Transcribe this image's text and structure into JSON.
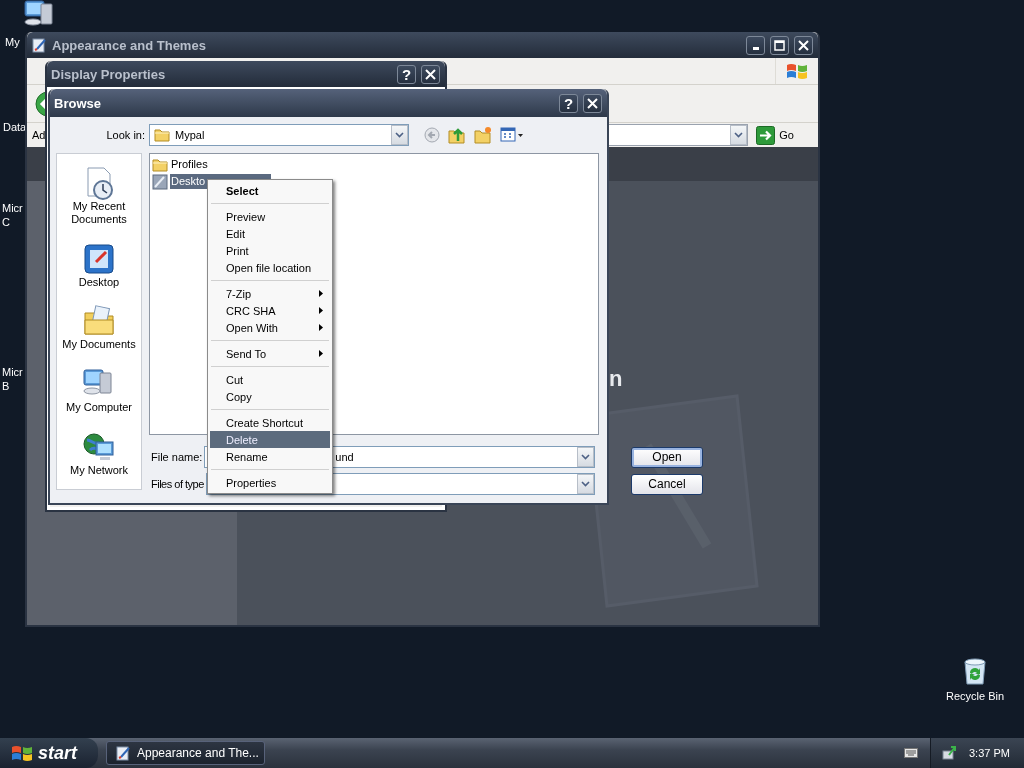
{
  "desktop": {
    "icons": [
      {
        "kind": "computer",
        "label_lines": [
          "My"
        ]
      },
      {
        "kind": "covered",
        "label_lines": [
          "Data"
        ]
      },
      {
        "kind": "covered",
        "label_lines": [
          "Micr",
          "C"
        ]
      },
      {
        "kind": "covered",
        "label_lines": [
          "Micr",
          "B"
        ]
      },
      {
        "kind": "recycle_bin",
        "label_lines": [
          "Recycle Bin"
        ]
      }
    ]
  },
  "appearance_window": {
    "title": "Appearance and Themes",
    "active": false,
    "address": {
      "label": "Ad",
      "go_label": "Go"
    },
    "pane_title_fragment": "n"
  },
  "display_properties_window": {
    "title": "Display Properties",
    "active": false,
    "help_label": "?"
  },
  "browse_dialog": {
    "title": "Browse",
    "active": true,
    "help_label": "?",
    "look_in": {
      "label": "Look in:",
      "value": "Mypal"
    },
    "places": [
      {
        "kind": "recent",
        "label": "My Recent Documents"
      },
      {
        "kind": "desktop",
        "label": "Desktop"
      },
      {
        "kind": "documents",
        "label": "My Documents"
      },
      {
        "kind": "computer",
        "label": "My Computer"
      },
      {
        "kind": "network",
        "label": "My Network"
      }
    ],
    "files": [
      {
        "kind": "folder",
        "name": "Profiles",
        "selected": false
      },
      {
        "kind": "image",
        "name": "Deskto",
        "selected": true
      }
    ],
    "file_name": {
      "label": "File name:",
      "value": "und"
    },
    "file_type": {
      "label": "Files of type"
    },
    "buttons": [
      {
        "label": "Open",
        "default": true
      },
      {
        "label": "Cancel",
        "default": false
      }
    ]
  },
  "context_menu": {
    "items": [
      {
        "kind": "item",
        "label": "Select",
        "bold": true,
        "submenu": false,
        "highlighted": false
      },
      {
        "kind": "separator"
      },
      {
        "kind": "item",
        "label": "Preview",
        "bold": false,
        "submenu": false,
        "highlighted": false
      },
      {
        "kind": "item",
        "label": "Edit",
        "bold": false,
        "submenu": false,
        "highlighted": false
      },
      {
        "kind": "item",
        "label": "Print",
        "bold": false,
        "submenu": false,
        "highlighted": false
      },
      {
        "kind": "item",
        "label": "Open file location",
        "bold": false,
        "submenu": false,
        "highlighted": false
      },
      {
        "kind": "separator"
      },
      {
        "kind": "item",
        "label": "7-Zip",
        "bold": false,
        "submenu": true,
        "highlighted": false
      },
      {
        "kind": "item",
        "label": "CRC SHA",
        "bold": false,
        "submenu": true,
        "highlighted": false
      },
      {
        "kind": "item",
        "label": "Open With",
        "bold": false,
        "submenu": true,
        "highlighted": false
      },
      {
        "kind": "separator"
      },
      {
        "kind": "item",
        "label": "Send To",
        "bold": false,
        "submenu": true,
        "highlighted": false
      },
      {
        "kind": "separator"
      },
      {
        "kind": "item",
        "label": "Cut",
        "bold": false,
        "submenu": false,
        "highlighted": false
      },
      {
        "kind": "item",
        "label": "Copy",
        "bold": false,
        "submenu": false,
        "highlighted": false
      },
      {
        "kind": "separator"
      },
      {
        "kind": "item",
        "label": "Create Shortcut",
        "bold": false,
        "submenu": false,
        "highlighted": false
      },
      {
        "kind": "item",
        "label": "Delete",
        "bold": false,
        "submenu": false,
        "highlighted": true
      },
      {
        "kind": "item",
        "label": "Rename",
        "bold": false,
        "submenu": false,
        "highlighted": false
      },
      {
        "kind": "separator"
      },
      {
        "kind": "item",
        "label": "Properties",
        "bold": false,
        "submenu": false,
        "highlighted": false
      }
    ]
  },
  "taskbar": {
    "start_label": "start",
    "tasks": [
      {
        "label": "Appearance and The..."
      }
    ],
    "clock": "3:37 PM"
  }
}
